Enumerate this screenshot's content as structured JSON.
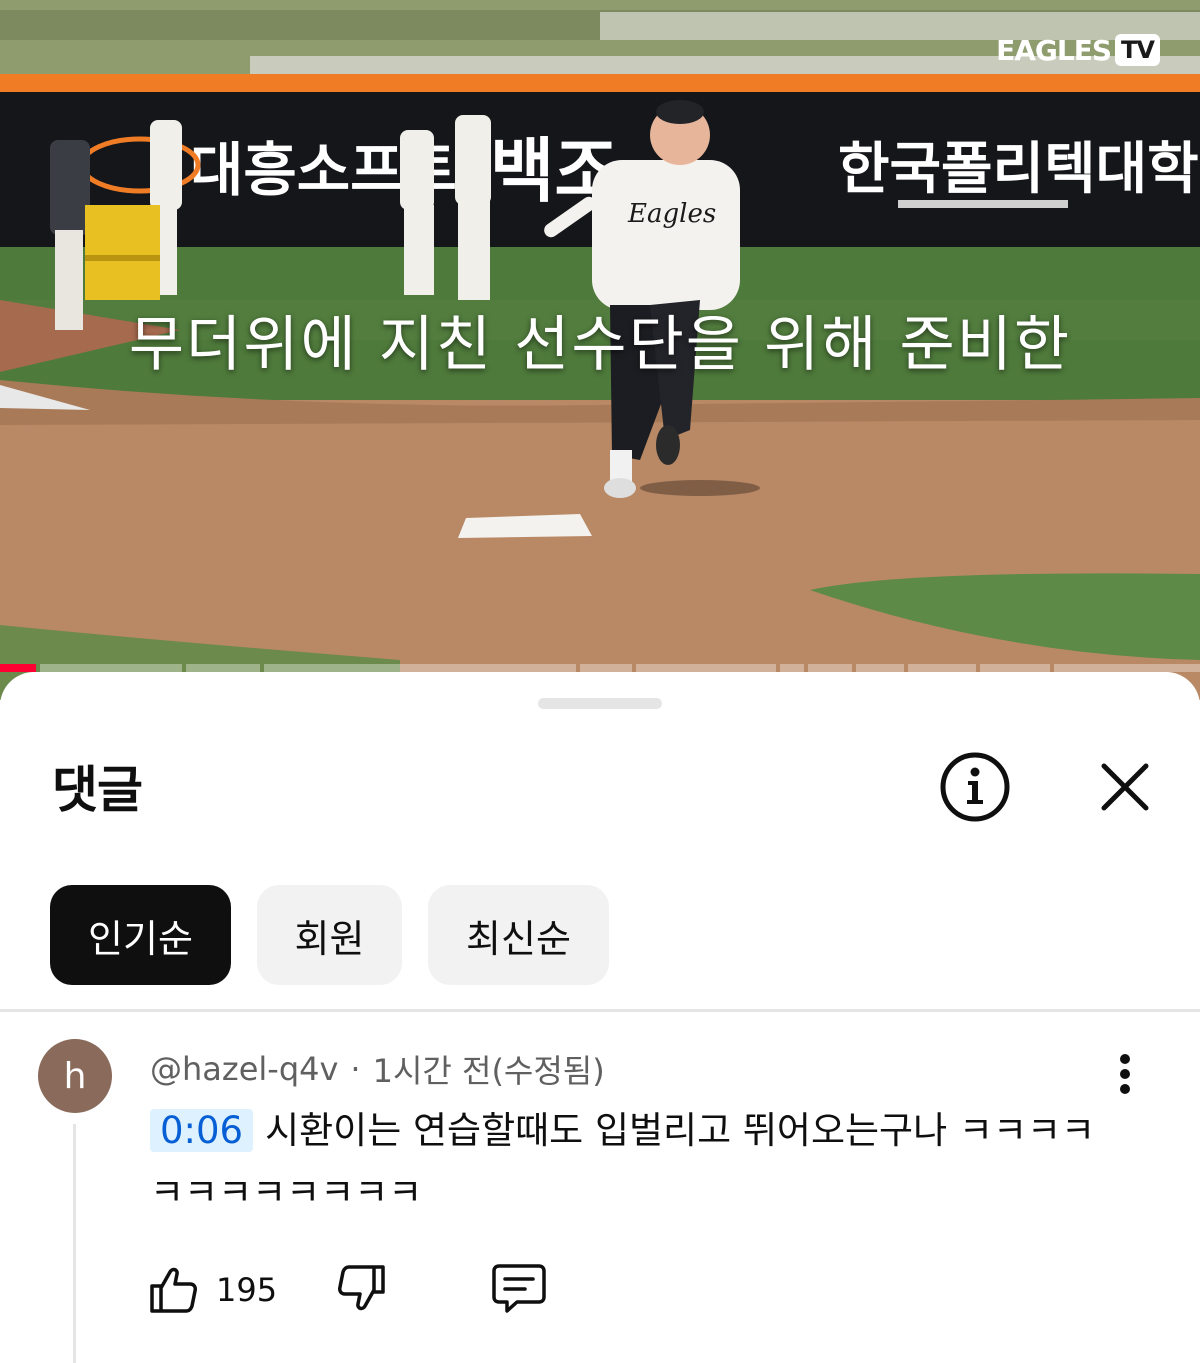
{
  "video": {
    "subtitle": "무더위에 지친 선수단을 위해 준비한",
    "banner_text_left": "대흥소프트",
    "banner_text_mid": "백조",
    "banner_text_right": "한국폴리텍대학",
    "jersey_text": "Eagles",
    "brand": {
      "name": "EAGLES",
      "tv": "TV"
    },
    "progress_fraction": 0.03,
    "accent_color": "#ff0033"
  },
  "comments_panel": {
    "title": "댓글",
    "info_icon": "info-icon",
    "close_icon": "close-icon",
    "sort_chips": [
      {
        "label": "인기순",
        "active": true
      },
      {
        "label": "회원",
        "active": false
      },
      {
        "label": "최신순",
        "active": false
      }
    ]
  },
  "comment": {
    "avatar_letter": "h",
    "avatar_color": "#8a6a5a",
    "author": "@hazel-q4v",
    "separator": "·",
    "time": "1시간 전(수정됨)",
    "timestamp_link": "0:06",
    "timestamp_color": "#065fd4",
    "text": "시환이는 연습할때도 입벌리고 뛰어오는구나 ㅋㅋㅋㅋㅋㅋㅋㅋㅋㅋㅋㅋ",
    "likes": "195",
    "more_icon": "more-vert-icon",
    "like_icon": "thumb-up-icon",
    "dislike_icon": "thumb-down-icon",
    "reply_icon": "reply-icon"
  }
}
